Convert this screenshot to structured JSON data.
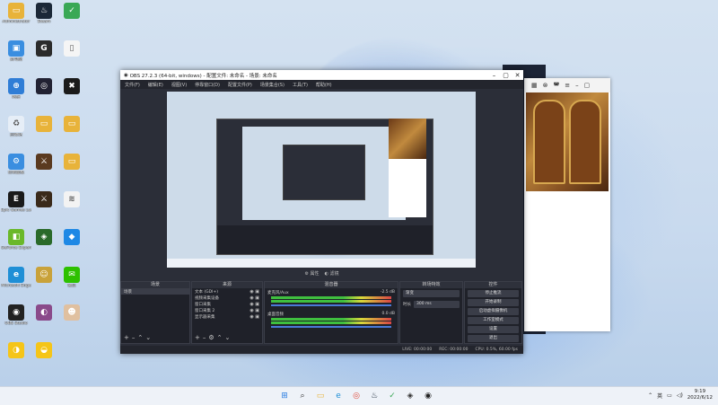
{
  "desktop": {
    "icons": [
      {
        "label": "Administrator",
        "color": "#e8b33a",
        "glyph": "▭"
      },
      {
        "label": "Steam",
        "color": "#1b2838",
        "glyph": "♨"
      },
      {
        "label": "",
        "color": "#3aa856",
        "glyph": "✓"
      },
      {
        "label": "此电脑",
        "color": "#3a8ee0",
        "glyph": "▣"
      },
      {
        "label": "",
        "color": "#2b2b2b",
        "glyph": "G"
      },
      {
        "label": "",
        "color": "#f5f5f5",
        "glyph": "▯"
      },
      {
        "label": "网络",
        "color": "#2f7dd6",
        "glyph": "⊕"
      },
      {
        "label": "",
        "color": "#223",
        "glyph": "◎"
      },
      {
        "label": "",
        "color": "#1b1b1b",
        "glyph": "✖"
      },
      {
        "label": "回收站",
        "color": "#e6eef7",
        "glyph": "♻"
      },
      {
        "label": "",
        "color": "#e8b33a",
        "glyph": "▭"
      },
      {
        "label": "",
        "color": "#e8b33a",
        "glyph": "▭"
      },
      {
        "label": "控制面板",
        "color": "#3a8ee0",
        "glyph": "⚙"
      },
      {
        "label": "",
        "color": "#5a3a20",
        "glyph": "⚔"
      },
      {
        "label": "",
        "color": "#e8b33a",
        "glyph": "▭"
      },
      {
        "label": "Epic Games Launcher",
        "color": "#1a1a1a",
        "glyph": "E"
      },
      {
        "label": "",
        "color": "#3a2a1a",
        "glyph": "⚔"
      },
      {
        "label": "",
        "color": "#f3f3f3",
        "glyph": "≋"
      },
      {
        "label": "GeForce Experience",
        "color": "#6ab82a",
        "glyph": "◧"
      },
      {
        "label": "",
        "color": "#2a6a2a",
        "glyph": "◈"
      },
      {
        "label": "",
        "color": "#1e88e5",
        "glyph": "◆"
      },
      {
        "label": "Microsoft Edge",
        "color": "#1f8fd6",
        "glyph": "e"
      },
      {
        "label": "",
        "color": "#c9a23a",
        "glyph": "☺"
      },
      {
        "label": "微信",
        "color": "#2dc100",
        "glyph": "✉"
      },
      {
        "label": "OBS Studio",
        "color": "#222",
        "glyph": "◉"
      },
      {
        "label": "",
        "color": "#8a4a8a",
        "glyph": "◐"
      },
      {
        "label": "",
        "color": "#e0c0a0",
        "glyph": "☻"
      },
      {
        "label": "",
        "color": "#f5c518",
        "glyph": "◑"
      },
      {
        "label": "",
        "color": "#f5c518",
        "glyph": "◒"
      }
    ]
  },
  "obs": {
    "title": "OBS 27.2.3 (64-bit, windows) - 配置文件: 未命名 - 场景: 未命名",
    "menu": [
      "文件(F)",
      "编辑(E)",
      "视图(V)",
      "停靠窗口(D)",
      "配置文件(P)",
      "场景集合(S)",
      "工具(T)",
      "帮助(H)"
    ],
    "scene_buttons": [
      "属性",
      "滤镜"
    ],
    "docks": {
      "scenes_title": "场景",
      "scene_item": "场景",
      "sources_title": "来源",
      "sources": [
        "文本 (GDI+)",
        "视频采集设备",
        "窗口采集",
        "窗口采集 2",
        "显示器采集"
      ],
      "mixer_title": "混音器",
      "mixer": [
        {
          "name": "麦克风/Aux",
          "db": "-2.5 dB"
        },
        {
          "name": "桌面音频",
          "db": "0.0 dB"
        }
      ],
      "transitions_title": "转场特效",
      "transition_value": "渐变",
      "duration_label": "时长",
      "duration_value": "300 ms",
      "controls_title": "控件",
      "controls": [
        "停止推流",
        "开始录制",
        "启动虚拟摄像机",
        "工作室模式",
        "设置",
        "退出"
      ]
    },
    "status": {
      "live": "LIVE: 00:00:00",
      "rec": "REC: 00:00:00",
      "cpu": "CPU: 0.5%, 60.00 fps"
    }
  },
  "taskbar": {
    "icons": [
      {
        "name": "start",
        "glyph": "⊞",
        "color": "#2a7de1"
      },
      {
        "name": "search",
        "glyph": "⌕",
        "color": "#333"
      },
      {
        "name": "file-explorer",
        "glyph": "▭",
        "color": "#e8b33a"
      },
      {
        "name": "edge",
        "glyph": "e",
        "color": "#1f8fd6"
      },
      {
        "name": "chrome",
        "glyph": "◎",
        "color": "#e04a3a"
      },
      {
        "name": "steam",
        "glyph": "♨",
        "color": "#1b2838"
      },
      {
        "name": "app-green",
        "glyph": "✓",
        "color": "#3aa856"
      },
      {
        "name": "app-dark",
        "glyph": "◈",
        "color": "#333"
      },
      {
        "name": "obs",
        "glyph": "◉",
        "color": "#222"
      }
    ],
    "time": "9:19",
    "date": "2022/6/12",
    "ime": "英"
  }
}
